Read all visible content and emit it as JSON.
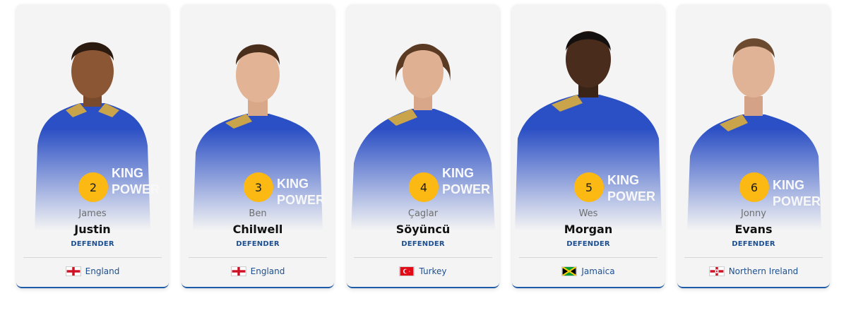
{
  "players": [
    {
      "number": "2",
      "first_name": "James",
      "last_name": "Justin",
      "position": "DEFENDER",
      "nationality": "England",
      "flag_icon": "flag-england-icon"
    },
    {
      "number": "3",
      "first_name": "Ben",
      "last_name": "Chilwell",
      "position": "DEFENDER",
      "nationality": "England",
      "flag_icon": "flag-england-icon"
    },
    {
      "number": "4",
      "first_name": "Çaglar",
      "last_name": "Söyüncü",
      "position": "DEFENDER",
      "nationality": "Turkey",
      "flag_icon": "flag-turkey-icon"
    },
    {
      "number": "5",
      "first_name": "Wes",
      "last_name": "Morgan",
      "position": "DEFENDER",
      "nationality": "Jamaica",
      "flag_icon": "flag-jamaica-icon"
    },
    {
      "number": "6",
      "first_name": "Jonny",
      "last_name": "Evans",
      "position": "DEFENDER",
      "nationality": "Northern Ireland",
      "flag_icon": "flag-northern-ireland-icon"
    }
  ],
  "colors": {
    "badge": "#fdb913",
    "position_text": "#1d4f91",
    "jersey": "#2b4fc4",
    "card_bg": "#f4f4f4"
  }
}
